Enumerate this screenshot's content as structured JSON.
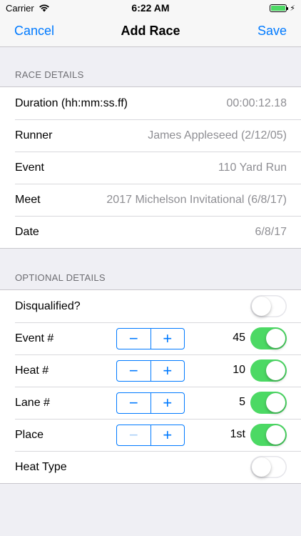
{
  "status_bar": {
    "carrier": "Carrier",
    "time": "6:22 AM",
    "wifi_icon": "wifi-icon",
    "battery_icon": "battery-icon",
    "battery_color": "#4cd964"
  },
  "navbar": {
    "cancel_label": "Cancel",
    "title": "Add Race",
    "save_label": "Save",
    "accent_color": "#007aff"
  },
  "race_details": {
    "header": "RACE DETAILS",
    "rows": [
      {
        "label": "Duration (hh:mm:ss.ff)",
        "value": "00:00:12.18"
      },
      {
        "label": "Runner",
        "value": "James Appleseed (2/12/05)"
      },
      {
        "label": "Event",
        "value": "110 Yard Run"
      },
      {
        "label": "Meet",
        "value": "2017 Michelson Invitational (6/8/17)"
      },
      {
        "label": "Date",
        "value": "6/8/17"
      }
    ]
  },
  "optional_details": {
    "header": "OPTIONAL DETAILS",
    "disqualified": {
      "label": "Disqualified?",
      "on": false
    },
    "event_num": {
      "label": "Event #",
      "value": "45",
      "on": true
    },
    "heat_num": {
      "label": "Heat #",
      "value": "10",
      "on": true
    },
    "lane_num": {
      "label": "Lane #",
      "value": "5",
      "on": true
    },
    "place": {
      "label": "Place",
      "value": "1st",
      "on": true,
      "minus_disabled": true
    },
    "heat_type": {
      "label": "Heat Type",
      "on": false
    },
    "stepper_minus": "−",
    "stepper_plus": "+"
  },
  "colors": {
    "switch_on": "#4cd964",
    "background": "#efeff4"
  }
}
